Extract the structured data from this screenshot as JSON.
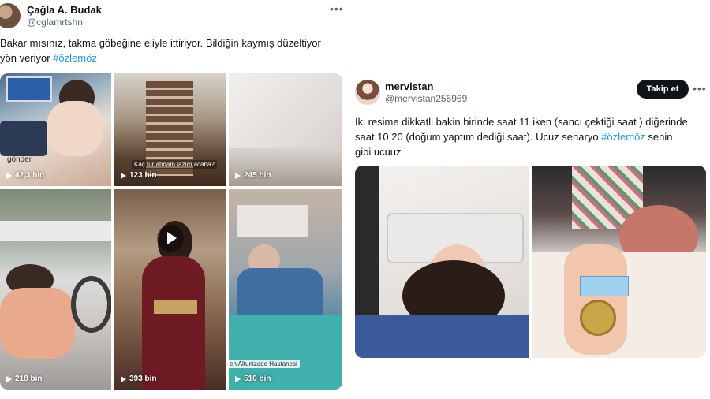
{
  "left_tweet": {
    "author_name": "Çağla A. Budak",
    "author_handle": "@cglamrtshn",
    "more_label": "•••",
    "text_line1": "Bakar mısınız, takma göbeğine eliyle ittiriyor. Bildiğin kaymış düzeltiyor",
    "text_line2_prefix": "yön veriyor ",
    "hashtag": "#özlemöz",
    "videos": [
      {
        "views": "42,3 bin",
        "overlay": "gönder"
      },
      {
        "views": "123 bin",
        "overlay": "Kaç tur atmam lazım acaba?"
      },
      {
        "views": "245 bin"
      },
      {
        "views": "218 bin"
      },
      {
        "views": "393 bin"
      },
      {
        "views": "510 bin",
        "overlay": "en Altunizade Hastanesi"
      }
    ],
    "colors": {
      "hashtag": "#1d9bf0"
    }
  },
  "right_tweet": {
    "author_name": "mervistan",
    "author_handle": "@mervistan256969",
    "follow_label": "Takip et",
    "more_label": "•••",
    "text_line1": "İki resime dikkatli bakin birinde saat 11 iken (sancı çektiği saat ) diğerinde",
    "text_line2_prefix": "saat 10.20 (doğum yaptım dediği saat). Ucuz senaryo ",
    "hashtag": "#özlemöz",
    "text_line2_suffix": " senin",
    "text_line3": "gibi ucuuz"
  }
}
